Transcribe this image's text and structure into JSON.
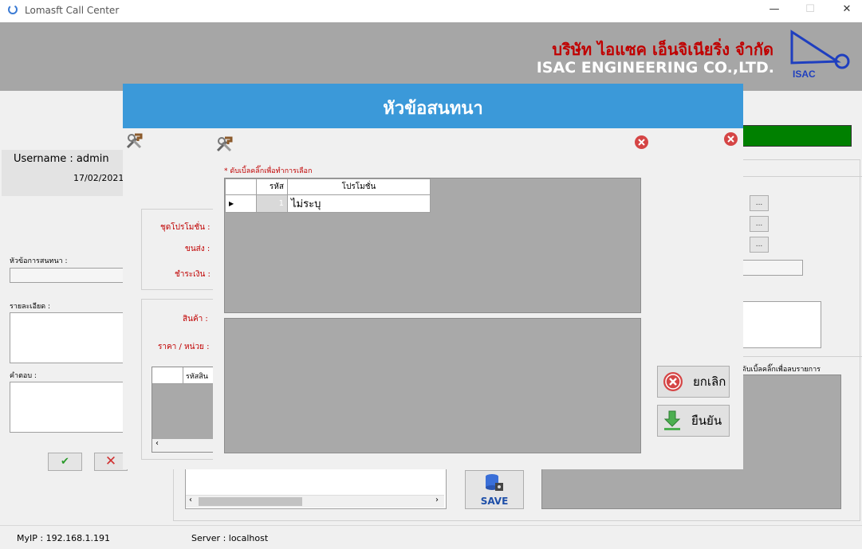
{
  "window": {
    "title": "Lomasft Call Center",
    "min": "—",
    "max": "☐",
    "close": "✕"
  },
  "banner": {
    "company_th": "บริษัท ไอแซค เอ็นจิเนียริ่ง จำกัด",
    "company_en": "ISAC ENGINEERING CO.,LTD.",
    "logo_text": "ISAC"
  },
  "user": {
    "username": "Username : admin",
    "date": "17/02/2021"
  },
  "left_form": {
    "topic_label": "หัวข้อการสนทนา :",
    "detail_label": "รายละเอียด :",
    "answer_label": "คำตอบ :",
    "ok_symbol": "✔",
    "cancel_symbol": "✕"
  },
  "middle_form": {
    "promo_set_label": "ชุดโปรโมชั่น :",
    "ship_label": "ขนส่ง :",
    "pay_label": "ชำระเงิน :",
    "product_label": "สินค้า :",
    "price_label": "ราคา / หน่วย :",
    "table_header": "รหัสสิน"
  },
  "right_form": {
    "dots": "...",
    "hint": "ดับเบิ้ลคลิ๊กเพื่อลบรายการ",
    "save_label": "SAVE"
  },
  "dialog": {
    "title": "หัวข้อสนทนา"
  },
  "inner_dialog": {
    "hint": "* ดับเบิ้ลคลิ๊กเพื่อทำการเลือก",
    "columns": [
      "รหัส",
      "โปรโมชั่น"
    ],
    "rows": [
      {
        "code": "1",
        "promo": "ไม่ระบุ"
      }
    ],
    "cancel_label": "ยกเลิก",
    "confirm_label": "ยืนยัน"
  },
  "status": {
    "ip": "MyIP : 192.168.1.191",
    "server": "Server : localhost"
  },
  "colors": {
    "accent": "#3b99d9",
    "brand_red": "#c00000",
    "green_bar": "#008000",
    "grid_gray": "#a9a9a9"
  },
  "icons": [
    "headset-icon",
    "tools-icon",
    "close-icon",
    "check-icon",
    "cancel-icon",
    "database-save-icon",
    "download-arrow-icon"
  ]
}
